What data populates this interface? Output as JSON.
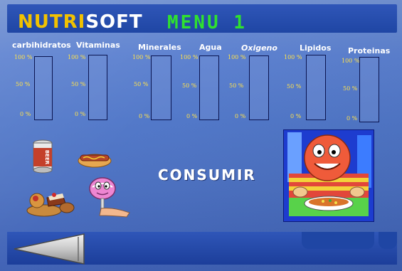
{
  "header": {
    "logo_part1": "NUTRI",
    "logo_part2": "SOFT",
    "menu_title": "MENU 1"
  },
  "nutrients": [
    {
      "label": "carbihidratos",
      "ticks": [
        "100 %",
        "50 %",
        "0 %"
      ],
      "level": 0
    },
    {
      "label": "Vitaminas",
      "ticks": [
        "100 %",
        "50 %",
        "0 %"
      ],
      "level": 0
    },
    {
      "label": "Minerales",
      "ticks": [
        "100 %",
        "50 %",
        "0 %"
      ],
      "level": 0
    },
    {
      "label": "Agua",
      "ticks": [
        "100 %",
        "50 %",
        "0 %"
      ],
      "level": 0
    },
    {
      "label": "Oxigeno",
      "ticks": [
        "100 %",
        "50 %",
        "0 %"
      ],
      "level": 0
    },
    {
      "label": "Lipidos",
      "ticks": [
        "100 %",
        "50 %",
        "0 %"
      ],
      "level": 0
    },
    {
      "label": "Proteinas",
      "ticks": [
        "100 %",
        "50 %",
        "0 %"
      ],
      "level": 0
    }
  ],
  "actions": {
    "consume_label": "CONSUMIR",
    "beer_can_text": "BEER"
  },
  "colors": {
    "logo_yellow": "#f2c200",
    "menu_green": "#2fe12f",
    "tick_yellow": "#ffe14a",
    "bar_border": "#0a1450"
  },
  "icons": {
    "back": "left-arrow-icon",
    "foods": [
      "beer-can-icon",
      "hot-dog-icon",
      "pastries-icon",
      "lollipop-icon"
    ],
    "character": "boy-eating-soup-illustration"
  }
}
